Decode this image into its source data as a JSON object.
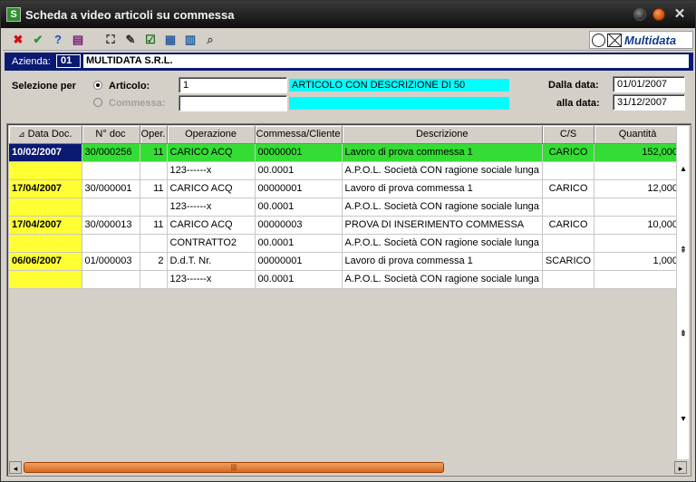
{
  "window": {
    "title": "Scheda a video articoli su commessa",
    "app_icon_glyph": "S",
    "close_glyph": "✕"
  },
  "toolbar": {
    "buttons": [
      {
        "name": "cancel-icon",
        "glyph": "✖",
        "color": "#d01010"
      },
      {
        "name": "confirm-icon",
        "glyph": "✔",
        "color": "#2a9a2a"
      },
      {
        "name": "help-icon",
        "glyph": "?",
        "color": "#2050c0"
      },
      {
        "name": "book-icon",
        "glyph": "▤",
        "color": "#7a1a7a"
      },
      {
        "name": "binoculars-icon",
        "glyph": "⛶",
        "color": "#202020"
      },
      {
        "name": "edit-icon",
        "glyph": "✎",
        "color": "#303030"
      },
      {
        "name": "checkbox-icon",
        "glyph": "☑",
        "color": "#1a6a1a"
      },
      {
        "name": "document-icon",
        "glyph": "▦",
        "color": "#3060a0"
      },
      {
        "name": "table-icon",
        "glyph": "▥",
        "color": "#2060a0"
      },
      {
        "name": "search-icon",
        "glyph": "⌕",
        "color": "#505050"
      }
    ],
    "logo_text": "Multidata"
  },
  "azienda": {
    "label": "Azienda:",
    "code": "01",
    "name": "MULTIDATA S.R.L."
  },
  "selection": {
    "label": "Selezione per",
    "articolo_label": "Articolo:",
    "articolo_value": "1",
    "articolo_desc": "ARTICOLO CON DESCRIZIONE DI 50",
    "commessa_label": "Commessa:",
    "commessa_value": "",
    "commessa_desc": "",
    "dalla_label": "Dalla data:",
    "dalla_value": "01/01/2007",
    "alla_label": "alla data:",
    "alla_value": "31/12/2007"
  },
  "grid": {
    "sort_indicator": "⊿",
    "columns": [
      "Data Doc.",
      "N° doc",
      "Oper.",
      "Operazione",
      "Commessa/Cliente",
      "Descrizione",
      "C/S",
      "Quantità"
    ],
    "rows": [
      {
        "hl": true,
        "cells": [
          "10/02/2007",
          "30/000256",
          "11",
          "CARICO ACQ",
          "00000001",
          "Lavoro di prova commessa 1",
          "CARICO",
          "152,000"
        ]
      },
      {
        "hl": false,
        "cells": [
          "",
          "",
          "",
          "123------x",
          "00.0001",
          "A.P.O.L. Società CON ragione sociale lunga",
          "",
          ""
        ]
      },
      {
        "hl": false,
        "cells": [
          "17/04/2007",
          "30/000001",
          "11",
          "CARICO ACQ",
          "00000001",
          "Lavoro di prova commessa 1",
          "CARICO",
          "12,000"
        ]
      },
      {
        "hl": false,
        "cells": [
          "",
          "",
          "",
          "123------x",
          "00.0001",
          "A.P.O.L. Società CON ragione sociale lunga",
          "",
          ""
        ]
      },
      {
        "hl": false,
        "cells": [
          "17/04/2007",
          "30/000013",
          "11",
          "CARICO ACQ",
          "00000003",
          "PROVA DI INSERIMENTO COMMESSA",
          "CARICO",
          "10,000"
        ]
      },
      {
        "hl": false,
        "cells": [
          "",
          "",
          "",
          "CONTRATTO2",
          "00.0001",
          "A.P.O.L. Società CON ragione sociale lunga",
          "",
          ""
        ]
      },
      {
        "hl": false,
        "cells": [
          "06/06/2007",
          "01/000003",
          "2",
          "D.d.T. Nr.",
          "00000001",
          "Lavoro di prova commessa 1",
          "SCARICO",
          "1,000"
        ]
      },
      {
        "hl": false,
        "cells": [
          "",
          "",
          "",
          "123------x",
          "00.0001",
          "A.P.O.L. Società CON ragione sociale lunga",
          "",
          ""
        ]
      }
    ]
  },
  "scroll": {
    "up": "▴",
    "page_up": "⇞",
    "page_down": "⇟",
    "down": "▾",
    "left": "◂",
    "right": "▸",
    "thumb_grip": "|||"
  }
}
